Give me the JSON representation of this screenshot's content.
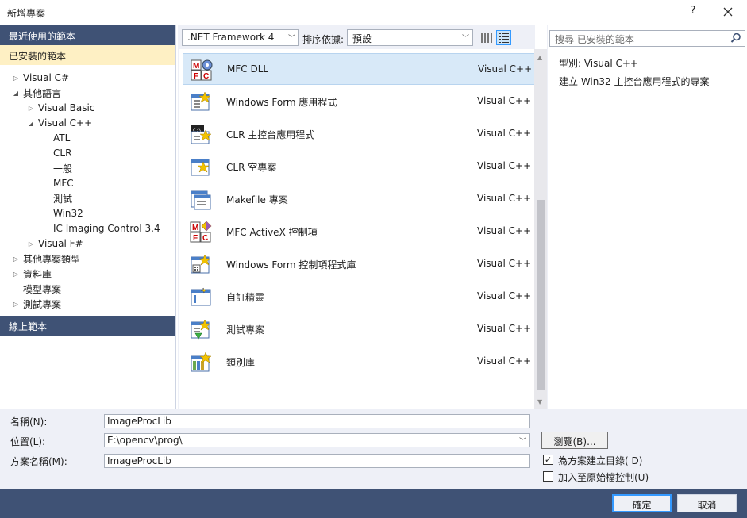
{
  "window": {
    "title": "新增專案",
    "help_label": "?",
    "close_icon": "close-icon"
  },
  "left_pane": {
    "recent_label": "最近使用的範本",
    "installed_label": "已安裝的範本",
    "online_label": "線上範本",
    "tree": [
      {
        "label": "Visual C#",
        "arrow": "collapsed"
      },
      {
        "label": "其他語言",
        "arrow": "expanded"
      },
      {
        "label": "Visual Basic",
        "arrow": "collapsed"
      },
      {
        "label": "Visual C++",
        "arrow": "expanded"
      },
      {
        "label": "ATL",
        "arrow": "none"
      },
      {
        "label": "CLR",
        "arrow": "none"
      },
      {
        "label": "一般",
        "arrow": "none"
      },
      {
        "label": "MFC",
        "arrow": "none"
      },
      {
        "label": "測試",
        "arrow": "none"
      },
      {
        "label": "Win32",
        "arrow": "none"
      },
      {
        "label": "IC Imaging Control 3.4",
        "arrow": "none"
      },
      {
        "label": "Visual F#",
        "arrow": "collapsed"
      },
      {
        "label": "其他專案類型",
        "arrow": "collapsed"
      },
      {
        "label": "資料庫",
        "arrow": "collapsed"
      },
      {
        "label": "模型專案",
        "arrow": "none"
      },
      {
        "label": "測試專案",
        "arrow": "collapsed"
      }
    ]
  },
  "toolbar": {
    "framework": ".NET Framework 4",
    "sort_label": "排序依據:",
    "sort_value": "預設"
  },
  "templates": [
    {
      "name": "MFC DLL",
      "lang": "Visual C++",
      "icon": "mfc-dll-icon"
    },
    {
      "name": "Windows Form 應用程式",
      "lang": "Visual C++",
      "icon": "windows-form-app-icon"
    },
    {
      "name": "CLR 主控台應用程式",
      "lang": "Visual C++",
      "icon": "clr-console-app-icon"
    },
    {
      "name": "CLR 空專案",
      "lang": "Visual C++",
      "icon": "clr-empty-project-icon"
    },
    {
      "name": "Makefile 專案",
      "lang": "Visual C++",
      "icon": "makefile-project-icon"
    },
    {
      "name": "MFC ActiveX 控制項",
      "lang": "Visual C++",
      "icon": "mfc-activex-icon"
    },
    {
      "name": "Windows Form 控制項程式庫",
      "lang": "Visual C++",
      "icon": "windows-form-control-library-icon"
    },
    {
      "name": "自訂精靈",
      "lang": "Visual C++",
      "icon": "custom-wizard-icon"
    },
    {
      "name": "測試專案",
      "lang": "Visual C++",
      "icon": "test-project-icon"
    },
    {
      "name": "類別庫",
      "lang": "Visual C++",
      "icon": "class-library-icon"
    }
  ],
  "details": {
    "search_placeholder": "搜尋 已安裝的範本",
    "type_line": "型別:  Visual C++",
    "description": "建立 Win32 主控台應用程式的專案"
  },
  "form": {
    "name_label": "名稱(N):",
    "name_value": "ImageProcLib",
    "location_label": "位置(L):",
    "location_value": "E:\\opencv\\prog\\",
    "solution_label": "方案名稱(M):",
    "solution_value": "ImageProcLib",
    "browse_label": "瀏覽(B)...",
    "create_dir_label": "為方案建立目錄( D)",
    "create_dir_checked": true,
    "source_control_label": "加入至原始檔控制(U)",
    "source_control_checked": false
  },
  "buttons": {
    "ok": "確定",
    "cancel": "取消"
  },
  "colors": {
    "navy": "#3f5275",
    "selected_header": "#fef0c4",
    "selected_row": "#d8e9f8",
    "form_bg": "#eef0f7",
    "focus": "#3399ff"
  }
}
